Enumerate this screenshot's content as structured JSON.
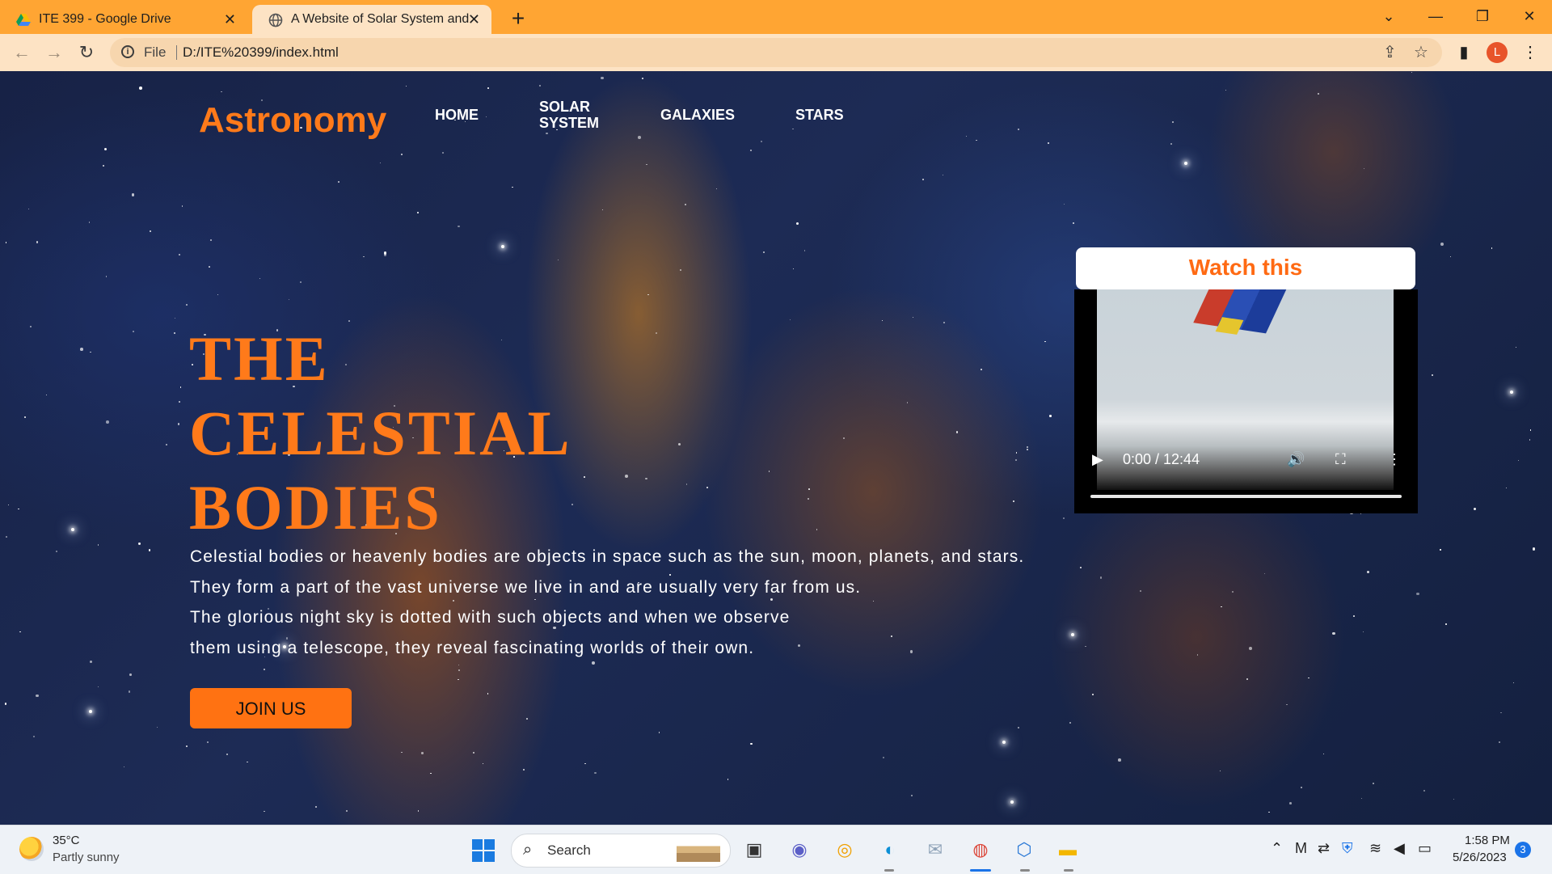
{
  "browser": {
    "tabs": [
      {
        "title": "ITE 399 - Google Drive",
        "active": false,
        "icon": "google-drive-icon"
      },
      {
        "title": "A Website of Solar System and ot",
        "active": true,
        "icon": "globe-icon"
      }
    ],
    "close_glyph": "✕",
    "new_tab_glyph": "+",
    "omnibox": {
      "scheme_label": "File",
      "url": "D:/ITE%20399/index.html"
    },
    "profile_initial": "L",
    "colors": {
      "tabbar": "#ffa533",
      "toolbar": "#fde3c4"
    }
  },
  "page": {
    "brand": "Astronomy",
    "nav": {
      "home": "HOME",
      "solar_line1": "SOLAR",
      "solar_line2": "SYSTEM",
      "galaxies": "GALAXIES",
      "stars": "STARS"
    },
    "hero": {
      "title_lines": [
        "THE",
        "CELESTIAL",
        "BODIES"
      ],
      "text_lines": [
        "Celestial bodies or heavenly bodies are objects in space such as the sun, moon, planets, and stars.",
        "They form a part of the vast universe we live in and are usually very far from us.",
        "The glorious night sky is dotted with such objects and when we observe",
        "them using a telescope, they reveal fascinating worlds of their own."
      ],
      "join_button": "JOIN US"
    },
    "video": {
      "heading": "Watch this",
      "time": "0:00 / 12:44",
      "progress": 0
    },
    "accent_color": "#ff7a1a"
  },
  "taskbar": {
    "weather": {
      "temp": "35°C",
      "desc": "Partly sunny"
    },
    "search_label": "Search",
    "clock": {
      "time": "1:58 PM",
      "date": "5/26/2023"
    },
    "notification_count": "3"
  }
}
